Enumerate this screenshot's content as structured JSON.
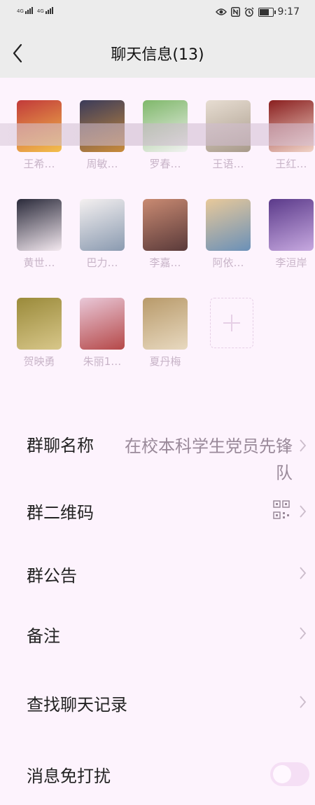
{
  "status_bar": {
    "network_1": "4G",
    "network_2": "4G",
    "time": "9:17",
    "battery_level": 0.85,
    "icons": [
      "eye-icon",
      "nfc-icon",
      "alarm-icon",
      "battery-icon"
    ]
  },
  "header": {
    "title": "聊天信息(13)",
    "back_icon": "chevron-left-icon"
  },
  "members": [
    {
      "name": "王希…",
      "colors": [
        "#c23a3a",
        "#f3c04c"
      ]
    },
    {
      "name": "周敏…",
      "colors": [
        "#3b3b5a",
        "#c98b3a"
      ]
    },
    {
      "name": "罗春…",
      "colors": [
        "#7fb86a",
        "#f2f2f2"
      ]
    },
    {
      "name": "王语…",
      "colors": [
        "#e7ddd2",
        "#a89a8a"
      ]
    },
    {
      "name": "王红…",
      "colors": [
        "#8a1f1f",
        "#f1d4c8"
      ]
    },
    {
      "name": "黄世…",
      "colors": [
        "#2a2a3a",
        "#f4e9f0"
      ]
    },
    {
      "name": "巴力…",
      "colors": [
        "#f4f0f0",
        "#8a9ab0"
      ]
    },
    {
      "name": "李嘉…",
      "colors": [
        "#c98a72",
        "#5a3a3a"
      ]
    },
    {
      "name": "阿依…",
      "colors": [
        "#e8c99a",
        "#6a90b8"
      ]
    },
    {
      "name": "李洹岸",
      "colors": [
        "#5b3a8a",
        "#c7a9e0"
      ]
    },
    {
      "name": "贺映勇",
      "colors": [
        "#9a8a3a",
        "#d8c78a"
      ]
    },
    {
      "name": "朱丽1…",
      "colors": [
        "#e9c8d8",
        "#b54848"
      ]
    },
    {
      "name": "夏丹梅",
      "colors": [
        "#b89a6a",
        "#e8d9c0"
      ]
    }
  ],
  "add_member_icon": "plus-icon",
  "settings": {
    "group_name_label": "群聊名称",
    "group_name_value": "在校本科学生党员先锋队",
    "qr_label": "群二维码",
    "qr_icon": "qr-code-icon",
    "notice_label": "群公告",
    "remark_label": "备注",
    "search_label": "查找聊天记录",
    "mute_label": "消息免打扰",
    "mute_on": false
  }
}
